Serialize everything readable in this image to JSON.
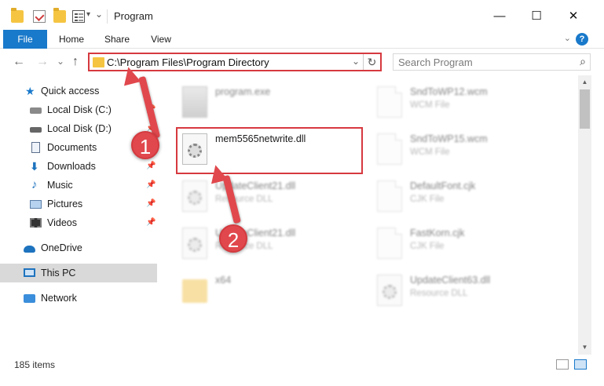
{
  "window": {
    "title": "Program",
    "minimize_glyph": "—",
    "maximize_glyph": "☐",
    "close_glyph": "✕"
  },
  "ribbon": {
    "tabs": [
      "File",
      "Home",
      "Share",
      "View"
    ],
    "help_glyph": "?",
    "expand_glyph": "⌄"
  },
  "navigation": {
    "back_glyph": "←",
    "forward_glyph": "→",
    "recent_glyph": "⌄",
    "up_glyph": "↑",
    "address_path": "C:\\Program Files\\Program Directory",
    "address_dropdown_glyph": "⌄",
    "refresh_glyph": "↻",
    "search_placeholder": "Search Program",
    "search_glyph": "⌕"
  },
  "sidebar": {
    "items": [
      {
        "label": "Quick access",
        "icon": "star-icon",
        "pinned": false
      },
      {
        "label": "Local Disk (C:)",
        "icon": "drive-icon",
        "pinned": true
      },
      {
        "label": "Local Disk (D:)",
        "icon": "drive-icon",
        "pinned": true
      },
      {
        "label": "Documents",
        "icon": "documents-icon",
        "pinned": true
      },
      {
        "label": "Downloads",
        "icon": "download-icon",
        "pinned": true
      },
      {
        "label": "Music",
        "icon": "music-icon",
        "pinned": true
      },
      {
        "label": "Pictures",
        "icon": "pictures-icon",
        "pinned": true
      },
      {
        "label": "Videos",
        "icon": "videos-icon",
        "pinned": true
      },
      {
        "label": "OneDrive",
        "icon": "cloud-icon",
        "pinned": false
      },
      {
        "label": "This PC",
        "icon": "computer-icon",
        "pinned": false,
        "selected": true
      },
      {
        "label": "Network",
        "icon": "network-icon",
        "pinned": false
      }
    ],
    "pin_glyph": "📌"
  },
  "files": {
    "left_column": [
      {
        "name": "program.exe",
        "type": ""
      },
      {
        "name": "mem5565netwrite.dll",
        "type": ""
      },
      {
        "name": "UpdateClient21.dll",
        "type": "Resource DLL"
      },
      {
        "name": "UpdateClient21.dll",
        "type": "Resource DLL"
      },
      {
        "name": "x64",
        "type": ""
      }
    ],
    "right_column": [
      {
        "name": "SndToWP12.wcm",
        "type": "WCM File"
      },
      {
        "name": "SndToWP15.wcm",
        "type": "WCM File"
      },
      {
        "name": "DefaultFont.cjk",
        "type": "CJK File"
      },
      {
        "name": "FastKorn.cjk",
        "type": "CJK File"
      },
      {
        "name": "UpdateClient63.dll",
        "type": "Resource DLL"
      }
    ]
  },
  "status": {
    "item_count": "185 items"
  },
  "callouts": {
    "step1": "1",
    "step2": "2"
  },
  "colors": {
    "accent": "#1979ca",
    "highlight_red": "#d6393f",
    "callout_red": "#e0484d"
  }
}
